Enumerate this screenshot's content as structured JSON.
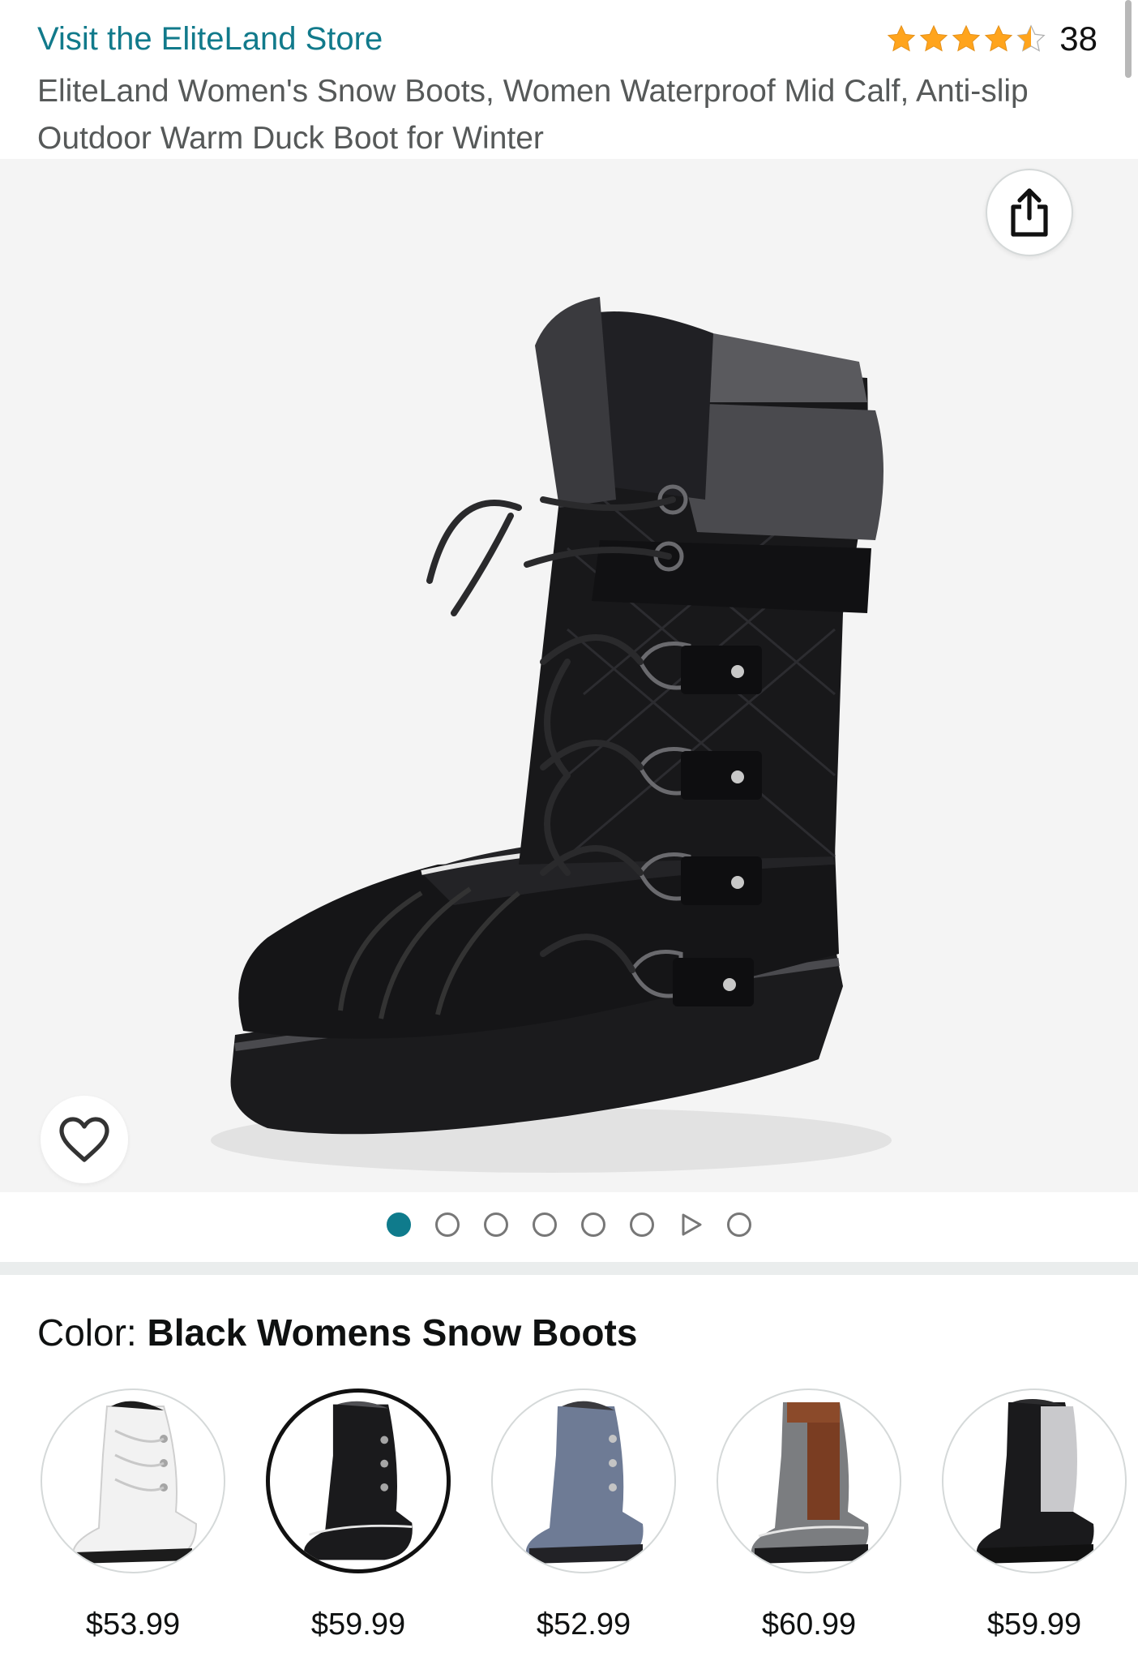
{
  "header": {
    "store_link": "Visit the EliteLand Store",
    "rating_stars": 4.5,
    "rating_count": "38",
    "title": "EliteLand Women's Snow Boots, Women Waterproof Mid Calf, Anti-slip Outdoor Warm Duck Boot for Winter"
  },
  "hero": {
    "share_icon": "share-icon",
    "favorite_icon": "heart-icon"
  },
  "pager": {
    "count": 8,
    "active_index": 0,
    "video_index": 6
  },
  "color": {
    "label": "Color: ",
    "value": "Black Womens Snow Boots"
  },
  "swatches": [
    {
      "color": "white",
      "price": "$53.99",
      "selected": false
    },
    {
      "color": "black",
      "price": "$59.99",
      "selected": true
    },
    {
      "color": "blue-grey",
      "price": "$52.99",
      "selected": false
    },
    {
      "color": "brown-grey",
      "price": "$60.99",
      "selected": false
    },
    {
      "color": "black-grey",
      "price": "$59.99",
      "selected": false
    }
  ],
  "colors": {
    "link": "#117a8b",
    "star": "#ffa41c",
    "active_dot": "#0f7b8c"
  }
}
